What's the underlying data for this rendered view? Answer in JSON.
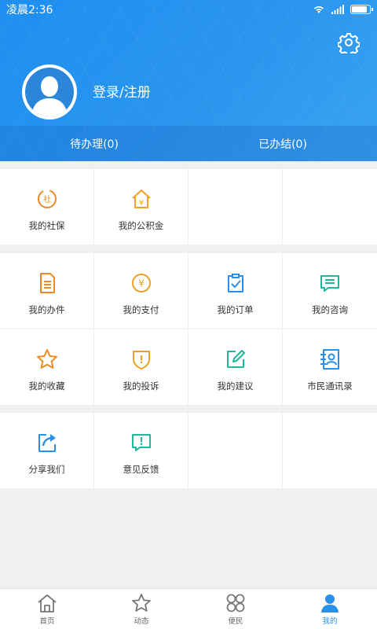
{
  "status": {
    "time": "凌晨2:36"
  },
  "profile": {
    "login": "登录/注册"
  },
  "tabs": [
    {
      "label": "待办理(0)"
    },
    {
      "label": "已办结(0)"
    }
  ],
  "section1": [
    {
      "label": "我的社保",
      "icon": "social-security-icon",
      "glyph": "社"
    },
    {
      "label": "我的公积金",
      "icon": "housing-fund-icon",
      "glyph": "¥"
    }
  ],
  "section2": [
    {
      "label": "我的办件",
      "icon": "document-icon"
    },
    {
      "label": "我的支付",
      "icon": "payment-icon",
      "glyph": "¥"
    },
    {
      "label": "我的订单",
      "icon": "order-icon"
    },
    {
      "label": "我的咨询",
      "icon": "consult-icon"
    },
    {
      "label": "我的收藏",
      "icon": "star-icon"
    },
    {
      "label": "我的投诉",
      "icon": "complaint-icon",
      "glyph": "!"
    },
    {
      "label": "我的建议",
      "icon": "edit-icon"
    },
    {
      "label": "市民通讯录",
      "icon": "contacts-icon"
    }
  ],
  "section3": [
    {
      "label": "分享我们",
      "icon": "share-icon"
    },
    {
      "label": "意见反馈",
      "icon": "feedback-icon",
      "glyph": "!"
    }
  ],
  "nav": [
    {
      "label": "首页",
      "icon": "home-icon"
    },
    {
      "label": "动态",
      "icon": "news-icon"
    },
    {
      "label": "便民",
      "icon": "services-icon"
    },
    {
      "label": "我的",
      "icon": "profile-icon",
      "active": true
    }
  ],
  "colors": {
    "orange": "#f08a24",
    "amber": "#f0a01e",
    "blue": "#2a8fe6",
    "teal": "#1fb89a",
    "header": "#2a95ee"
  }
}
